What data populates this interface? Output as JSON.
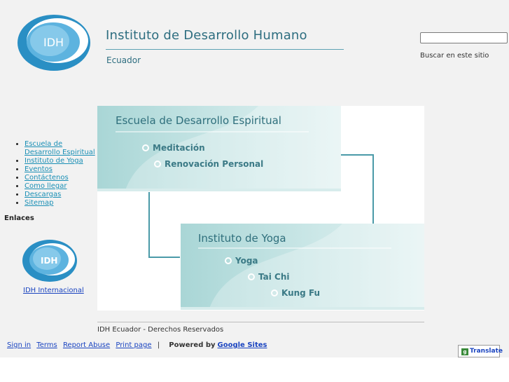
{
  "header": {
    "logo_text": "IDH",
    "site_title": "Instituto de Desarrollo Humano",
    "site_subtitle": "Ecuador",
    "search_placeholder": "",
    "search_label": "Buscar en este sitio"
  },
  "sidebar": {
    "nav_items": [
      {
        "label": "Escuela de Desarrollo Espiritual"
      },
      {
        "label": "Instituto de Yoga"
      },
      {
        "label": "Eventos"
      },
      {
        "label": "Contáctenos"
      },
      {
        "label": "Como llegar"
      },
      {
        "label": "Descargas"
      },
      {
        "label": "Sitemap"
      }
    ],
    "links_heading": "Enlaces",
    "partner_logo_text": "IDH",
    "partner_link": "IDH Internacional"
  },
  "main": {
    "panel1": {
      "title": "Escuela de Desarrollo Espiritual",
      "items": [
        "Meditación",
        "Renovación Personal"
      ]
    },
    "panel2": {
      "title": "Instituto de Yoga",
      "items": [
        "Yoga",
        "Tai Chi",
        "Kung Fu"
      ]
    },
    "colors": {
      "accent": "#2e6e80",
      "panel": "#bfe0e0",
      "link": "#1a8fb5"
    }
  },
  "footer": {
    "copyright": "IDH Ecuador - Derechos Reservados",
    "links": [
      "Sign in",
      "Terms",
      "Report Abuse",
      "Print page"
    ],
    "separator": "|",
    "powered_by": "Powered by",
    "powered_link": "Google Sites",
    "translate_label": "Translate",
    "translate_icon": "g"
  }
}
